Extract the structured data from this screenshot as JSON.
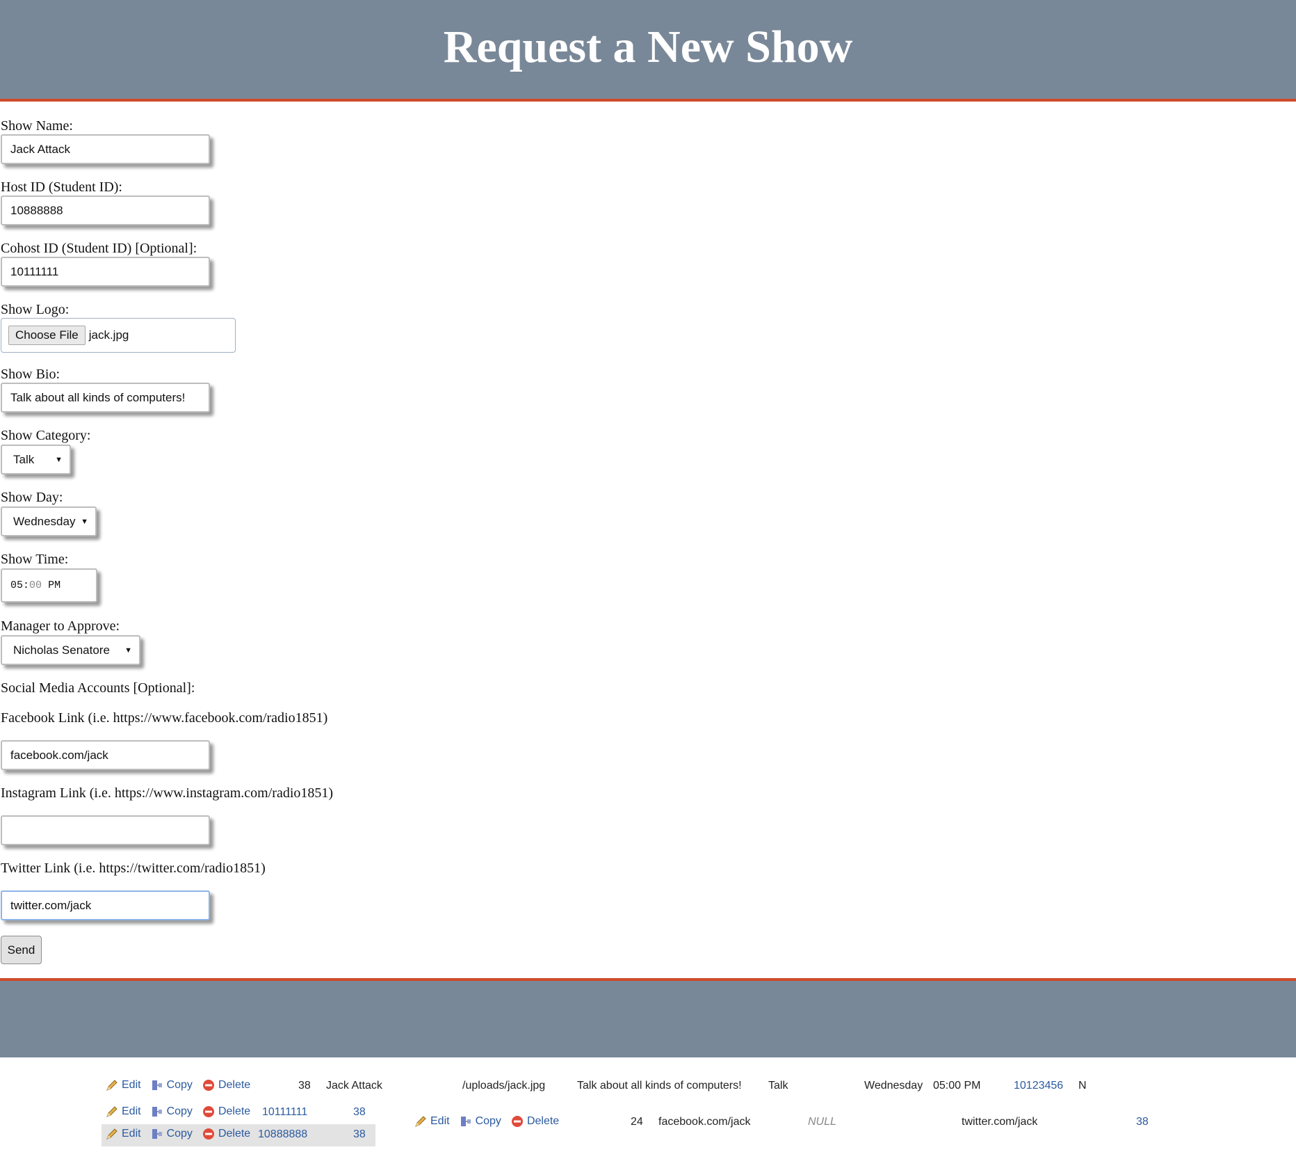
{
  "header": {
    "title": "Request a New Show"
  },
  "form": {
    "show_name": {
      "label": "Show Name:",
      "value": "Jack Attack"
    },
    "host_id": {
      "label": "Host ID (Student ID):",
      "value": "10888888"
    },
    "cohost_id": {
      "label": "Cohost ID (Student ID) [Optional]:",
      "value": "10111111"
    },
    "show_logo": {
      "label": "Show Logo:",
      "button": "Choose File",
      "file": "jack.jpg"
    },
    "show_bio": {
      "label": "Show Bio:",
      "value": "Talk about all kinds of computers!"
    },
    "show_category": {
      "label": "Show Category:",
      "value": "Talk"
    },
    "show_day": {
      "label": "Show Day:",
      "value": "Wednesday"
    },
    "show_time": {
      "label": "Show Time:",
      "hour": "05",
      "sep": ":",
      "minute": "00",
      "ampm": "PM"
    },
    "manager": {
      "label": "Manager to Approve:",
      "value": "Nicholas Senatore"
    },
    "social_heading": "Social Media Accounts [Optional]:",
    "facebook": {
      "label": "Facebook Link (i.e. https://www.facebook.com/radio1851)",
      "value": "facebook.com/jack"
    },
    "instagram": {
      "label": "Instagram Link (i.e. https://www.instagram.com/radio1851)",
      "value": ""
    },
    "twitter": {
      "label": "Twitter Link (i.e. https://twitter.com/radio1851)",
      "value": "twitter.com/jack"
    },
    "send_label": "Send"
  },
  "db_actions": {
    "edit": "Edit",
    "copy": "Copy",
    "delete": "Delete"
  },
  "db_rows": {
    "shows": {
      "id": "38",
      "name": "Jack Attack",
      "logo": "/uploads/jack.jpg",
      "bio": "Talk about all kinds of computers!",
      "category": "Talk",
      "day": "Wednesday",
      "time": "05:00 PM",
      "manager_id": "10123456",
      "flag": "N"
    },
    "cohost": {
      "student_id": "10111111",
      "show_id": "38"
    },
    "host": {
      "student_id": "10888888",
      "show_id": "38"
    },
    "social": {
      "id": "24",
      "facebook": "facebook.com/jack",
      "instagram": "NULL",
      "twitter": "twitter.com/jack",
      "show_id": "38"
    }
  },
  "icons": {
    "edit": "pencil-icon",
    "copy": "copy-icon",
    "delete": "delete-icon"
  }
}
